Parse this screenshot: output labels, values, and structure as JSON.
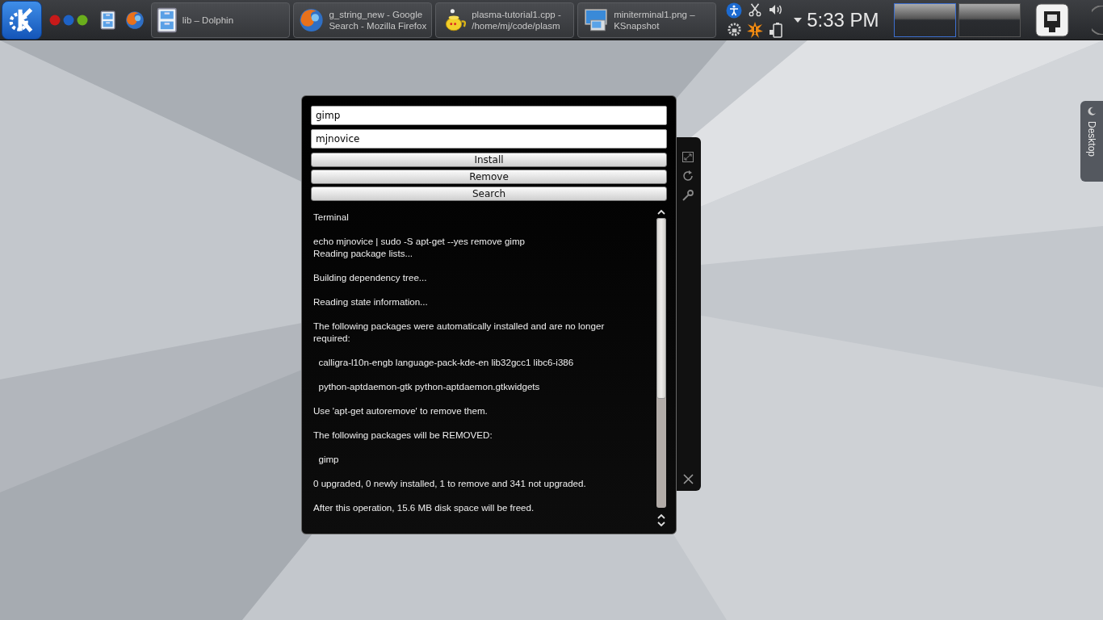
{
  "taskbar": {
    "launchers": [
      {
        "kind": "activities"
      },
      {
        "kind": "file-manager"
      },
      {
        "kind": "browser"
      }
    ],
    "tasks": [
      {
        "kind": "file-manager",
        "lines": [
          "lib – Dolphin"
        ]
      },
      {
        "kind": "browser",
        "lines": [
          "g_string_new - Google",
          "Search - Mozilla Firefox"
        ]
      },
      {
        "kind": "editor",
        "lines": [
          "plasma-tutorial1.cpp -",
          "/home/mj/code/plasm"
        ]
      },
      {
        "kind": "screenshot",
        "lines": [
          "miniterminal1.png –",
          "KSnapshot"
        ]
      }
    ],
    "clock": "5:33 PM",
    "pager": [
      {
        "selected": true
      },
      {
        "selected": false
      }
    ]
  },
  "widget": {
    "package_field": {
      "value": "gimp"
    },
    "password_field": {
      "value": "mjnovice"
    },
    "buttons": [
      "Install",
      "Remove",
      "Search"
    ],
    "terminal": {
      "title": "Terminal",
      "paragraphs": [
        [
          "echo mjnovice | sudo -S apt-get --yes remove gimp",
          "Reading package lists..."
        ],
        [
          "Building dependency tree..."
        ],
        [
          "Reading state information..."
        ],
        [
          "The following packages were automatically installed and are no longer",
          "required:"
        ],
        [
          "  calligra-l10n-engb language-pack-kde-en lib32gcc1 libc6-i386"
        ],
        [
          "  python-aptdaemon-gtk python-aptdaemon.gtkwidgets"
        ],
        [
          "Use 'apt-get autoremove' to remove them."
        ],
        [
          "The following packages will be REMOVED:"
        ],
        [
          "  gimp"
        ],
        [
          "0 upgraded, 0 newly installed, 1 to remove and 341 not upgraded."
        ],
        [
          "After this operation, 15.6 MB disk space will be freed."
        ]
      ]
    }
  },
  "desktop_toolbox": {
    "label": "Desktop"
  }
}
